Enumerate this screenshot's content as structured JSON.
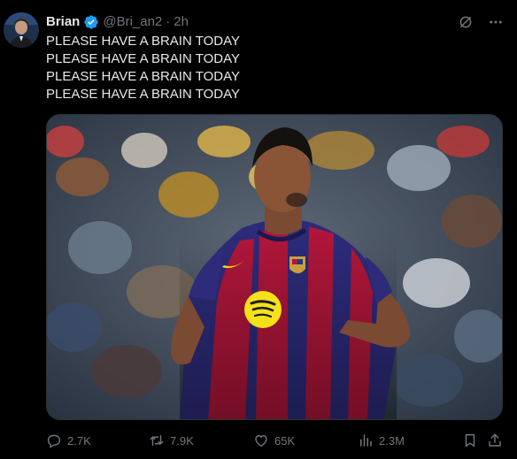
{
  "tweet": {
    "author": {
      "name": "Brian",
      "handle": "@Bri_an2",
      "separator": "·",
      "time": "2h",
      "verified": true
    },
    "text_lines": [
      "PLEASE HAVE A BRAIN TODAY",
      "PLEASE HAVE A BRAIN TODAY",
      "PLEASE HAVE A BRAIN TODAY",
      "PLEASE HAVE A BRAIN TODAY"
    ],
    "media": {
      "kind": "photo"
    },
    "metrics": {
      "replies": "2.7K",
      "retweets": "7.9K",
      "likes": "65K",
      "views": "2.3M"
    }
  },
  "icons": {
    "verified": "verified-badge-icon",
    "grok": "grok-icon",
    "more": "more-icon",
    "reply": "reply-icon",
    "retweet": "retweet-icon",
    "like": "heart-icon",
    "views": "views-icon",
    "bookmark": "bookmark-icon",
    "share": "share-icon"
  },
  "colors": {
    "background": "#000000",
    "text": "#e7e9ea",
    "muted": "#71767b",
    "verified": "#1d9bf0",
    "border": "#2f3336"
  }
}
